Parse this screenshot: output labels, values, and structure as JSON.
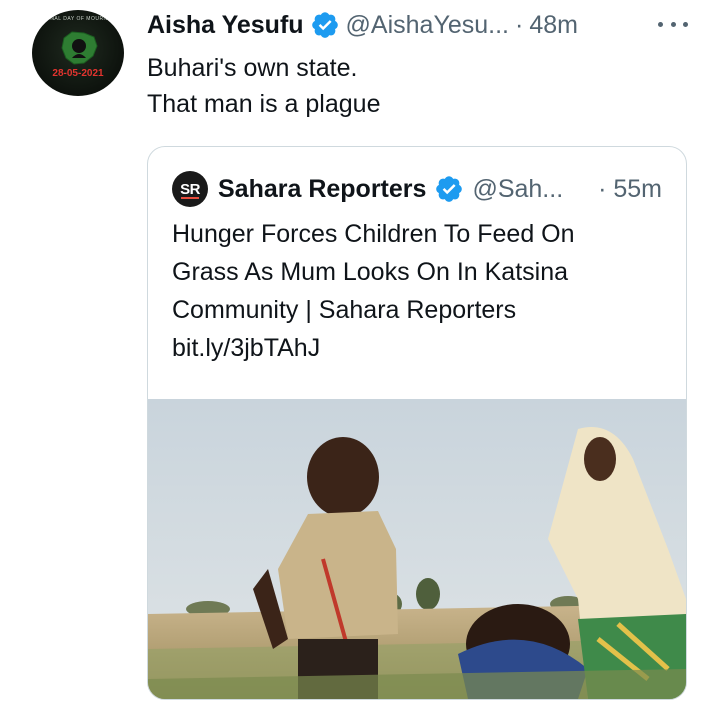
{
  "tweet": {
    "avatar": {
      "arc_text": "NAL DAY OF MOURN",
      "date_text": "28-05-2021"
    },
    "author_name": "Aisha Yesufu",
    "handle": "@AishaYesu...",
    "separator": "·",
    "time": "48m",
    "lines": [
      "Buhari's own state.",
      "That man is a plague"
    ]
  },
  "quoted_tweet": {
    "logo_text": "SR",
    "author_name": "Sahara Reporters",
    "handle": "@Sah...",
    "time": "· 55m",
    "lines": [
      "Hunger Forces Children To Feed On",
      "Grass As Mum Looks On In Katsina",
      "Community | Sahara Reporters",
      "bit.ly/3jbTAhJ"
    ]
  },
  "colors": {
    "verified_blue": "#1d9bf0",
    "secondary_text": "#536471",
    "border": "#cfd9de"
  },
  "icons": {
    "verified": "verified-badge-icon",
    "more": "more-horizontal-icon"
  }
}
